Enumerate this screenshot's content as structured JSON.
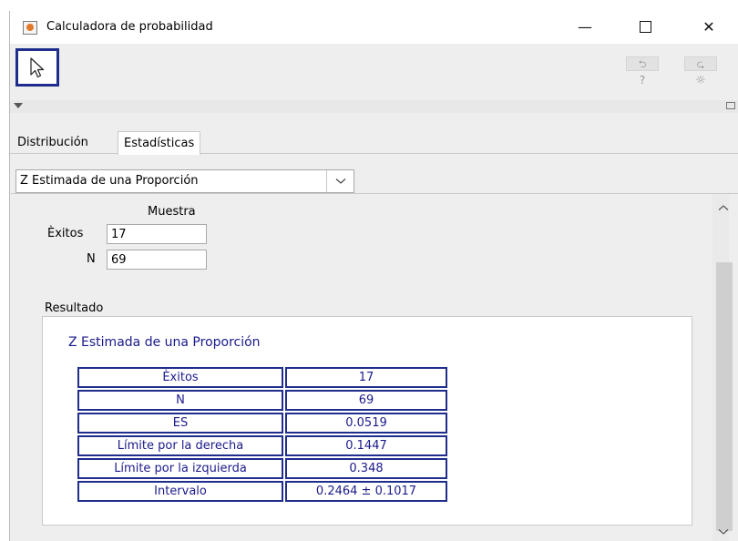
{
  "window": {
    "title": "Calculadora de probabilidad",
    "minimize": "—",
    "close": "✕"
  },
  "toolbar": {
    "undo": "⮌",
    "redo": "⮎",
    "help": "?",
    "settings": "☼"
  },
  "tabs": [
    {
      "label": "Distribución"
    },
    {
      "label": "Estadísticas"
    }
  ],
  "dropdown": {
    "selected": "Z Estimada de una Proporción"
  },
  "sample": {
    "section_label": "Muestra",
    "successes_label": "Èxitos",
    "successes_value": "17",
    "n_label": "N",
    "n_value": "69"
  },
  "result": {
    "section_label": "Resultado",
    "title": "Z Estimada de una Proporción",
    "rows": [
      {
        "label": "Èxitos",
        "value": "17"
      },
      {
        "label": "N",
        "value": "69"
      },
      {
        "label": "ES",
        "value": "0.0519"
      },
      {
        "label": "Límite por la derecha",
        "value": "0.1447"
      },
      {
        "label": "Límite por la izquierda",
        "value": "0.348"
      },
      {
        "label": "Intervalo",
        "value": "0.2464 ± 0.1017"
      }
    ]
  },
  "colors": {
    "accent": "#1f2e8c",
    "result_text": "#1a1a8c"
  }
}
